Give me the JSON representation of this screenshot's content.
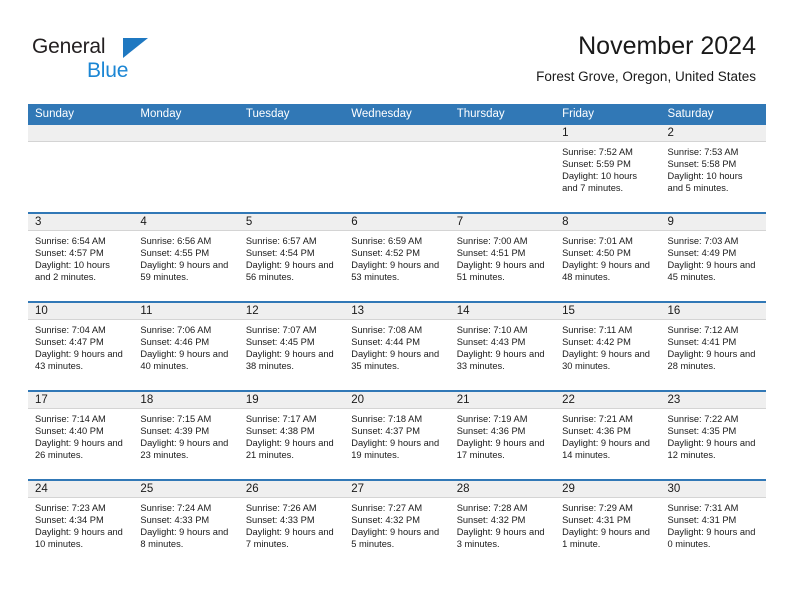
{
  "brand": {
    "name_top": "General",
    "name_bottom": "Blue",
    "logo_icon": "triangle-logo-icon",
    "accent_color": "#1b86d4"
  },
  "header": {
    "month_title": "November 2024",
    "location": "Forest Grove, Oregon, United States"
  },
  "calendar": {
    "header_color": "#3178b6",
    "date_bar_color": "#efefef",
    "day_names": [
      "Sunday",
      "Monday",
      "Tuesday",
      "Wednesday",
      "Thursday",
      "Friday",
      "Saturday"
    ],
    "weeks": [
      [
        {
          "date": "",
          "empty": true
        },
        {
          "date": "",
          "empty": true
        },
        {
          "date": "",
          "empty": true
        },
        {
          "date": "",
          "empty": true
        },
        {
          "date": "",
          "empty": true
        },
        {
          "date": "1",
          "sunrise": "Sunrise: 7:52 AM",
          "sunset": "Sunset: 5:59 PM",
          "daylight": "Daylight: 10 hours and 7 minutes."
        },
        {
          "date": "2",
          "sunrise": "Sunrise: 7:53 AM",
          "sunset": "Sunset: 5:58 PM",
          "daylight": "Daylight: 10 hours and 5 minutes."
        }
      ],
      [
        {
          "date": "3",
          "sunrise": "Sunrise: 6:54 AM",
          "sunset": "Sunset: 4:57 PM",
          "daylight": "Daylight: 10 hours and 2 minutes."
        },
        {
          "date": "4",
          "sunrise": "Sunrise: 6:56 AM",
          "sunset": "Sunset: 4:55 PM",
          "daylight": "Daylight: 9 hours and 59 minutes."
        },
        {
          "date": "5",
          "sunrise": "Sunrise: 6:57 AM",
          "sunset": "Sunset: 4:54 PM",
          "daylight": "Daylight: 9 hours and 56 minutes."
        },
        {
          "date": "6",
          "sunrise": "Sunrise: 6:59 AM",
          "sunset": "Sunset: 4:52 PM",
          "daylight": "Daylight: 9 hours and 53 minutes."
        },
        {
          "date": "7",
          "sunrise": "Sunrise: 7:00 AM",
          "sunset": "Sunset: 4:51 PM",
          "daylight": "Daylight: 9 hours and 51 minutes."
        },
        {
          "date": "8",
          "sunrise": "Sunrise: 7:01 AM",
          "sunset": "Sunset: 4:50 PM",
          "daylight": "Daylight: 9 hours and 48 minutes."
        },
        {
          "date": "9",
          "sunrise": "Sunrise: 7:03 AM",
          "sunset": "Sunset: 4:49 PM",
          "daylight": "Daylight: 9 hours and 45 minutes."
        }
      ],
      [
        {
          "date": "10",
          "sunrise": "Sunrise: 7:04 AM",
          "sunset": "Sunset: 4:47 PM",
          "daylight": "Daylight: 9 hours and 43 minutes."
        },
        {
          "date": "11",
          "sunrise": "Sunrise: 7:06 AM",
          "sunset": "Sunset: 4:46 PM",
          "daylight": "Daylight: 9 hours and 40 minutes."
        },
        {
          "date": "12",
          "sunrise": "Sunrise: 7:07 AM",
          "sunset": "Sunset: 4:45 PM",
          "daylight": "Daylight: 9 hours and 38 minutes."
        },
        {
          "date": "13",
          "sunrise": "Sunrise: 7:08 AM",
          "sunset": "Sunset: 4:44 PM",
          "daylight": "Daylight: 9 hours and 35 minutes."
        },
        {
          "date": "14",
          "sunrise": "Sunrise: 7:10 AM",
          "sunset": "Sunset: 4:43 PM",
          "daylight": "Daylight: 9 hours and 33 minutes."
        },
        {
          "date": "15",
          "sunrise": "Sunrise: 7:11 AM",
          "sunset": "Sunset: 4:42 PM",
          "daylight": "Daylight: 9 hours and 30 minutes."
        },
        {
          "date": "16",
          "sunrise": "Sunrise: 7:12 AM",
          "sunset": "Sunset: 4:41 PM",
          "daylight": "Daylight: 9 hours and 28 minutes."
        }
      ],
      [
        {
          "date": "17",
          "sunrise": "Sunrise: 7:14 AM",
          "sunset": "Sunset: 4:40 PM",
          "daylight": "Daylight: 9 hours and 26 minutes."
        },
        {
          "date": "18",
          "sunrise": "Sunrise: 7:15 AM",
          "sunset": "Sunset: 4:39 PM",
          "daylight": "Daylight: 9 hours and 23 minutes."
        },
        {
          "date": "19",
          "sunrise": "Sunrise: 7:17 AM",
          "sunset": "Sunset: 4:38 PM",
          "daylight": "Daylight: 9 hours and 21 minutes."
        },
        {
          "date": "20",
          "sunrise": "Sunrise: 7:18 AM",
          "sunset": "Sunset: 4:37 PM",
          "daylight": "Daylight: 9 hours and 19 minutes."
        },
        {
          "date": "21",
          "sunrise": "Sunrise: 7:19 AM",
          "sunset": "Sunset: 4:36 PM",
          "daylight": "Daylight: 9 hours and 17 minutes."
        },
        {
          "date": "22",
          "sunrise": "Sunrise: 7:21 AM",
          "sunset": "Sunset: 4:36 PM",
          "daylight": "Daylight: 9 hours and 14 minutes."
        },
        {
          "date": "23",
          "sunrise": "Sunrise: 7:22 AM",
          "sunset": "Sunset: 4:35 PM",
          "daylight": "Daylight: 9 hours and 12 minutes."
        }
      ],
      [
        {
          "date": "24",
          "sunrise": "Sunrise: 7:23 AM",
          "sunset": "Sunset: 4:34 PM",
          "daylight": "Daylight: 9 hours and 10 minutes."
        },
        {
          "date": "25",
          "sunrise": "Sunrise: 7:24 AM",
          "sunset": "Sunset: 4:33 PM",
          "daylight": "Daylight: 9 hours and 8 minutes."
        },
        {
          "date": "26",
          "sunrise": "Sunrise: 7:26 AM",
          "sunset": "Sunset: 4:33 PM",
          "daylight": "Daylight: 9 hours and 7 minutes."
        },
        {
          "date": "27",
          "sunrise": "Sunrise: 7:27 AM",
          "sunset": "Sunset: 4:32 PM",
          "daylight": "Daylight: 9 hours and 5 minutes."
        },
        {
          "date": "28",
          "sunrise": "Sunrise: 7:28 AM",
          "sunset": "Sunset: 4:32 PM",
          "daylight": "Daylight: 9 hours and 3 minutes."
        },
        {
          "date": "29",
          "sunrise": "Sunrise: 7:29 AM",
          "sunset": "Sunset: 4:31 PM",
          "daylight": "Daylight: 9 hours and 1 minute."
        },
        {
          "date": "30",
          "sunrise": "Sunrise: 7:31 AM",
          "sunset": "Sunset: 4:31 PM",
          "daylight": "Daylight: 9 hours and 0 minutes."
        }
      ]
    ]
  }
}
